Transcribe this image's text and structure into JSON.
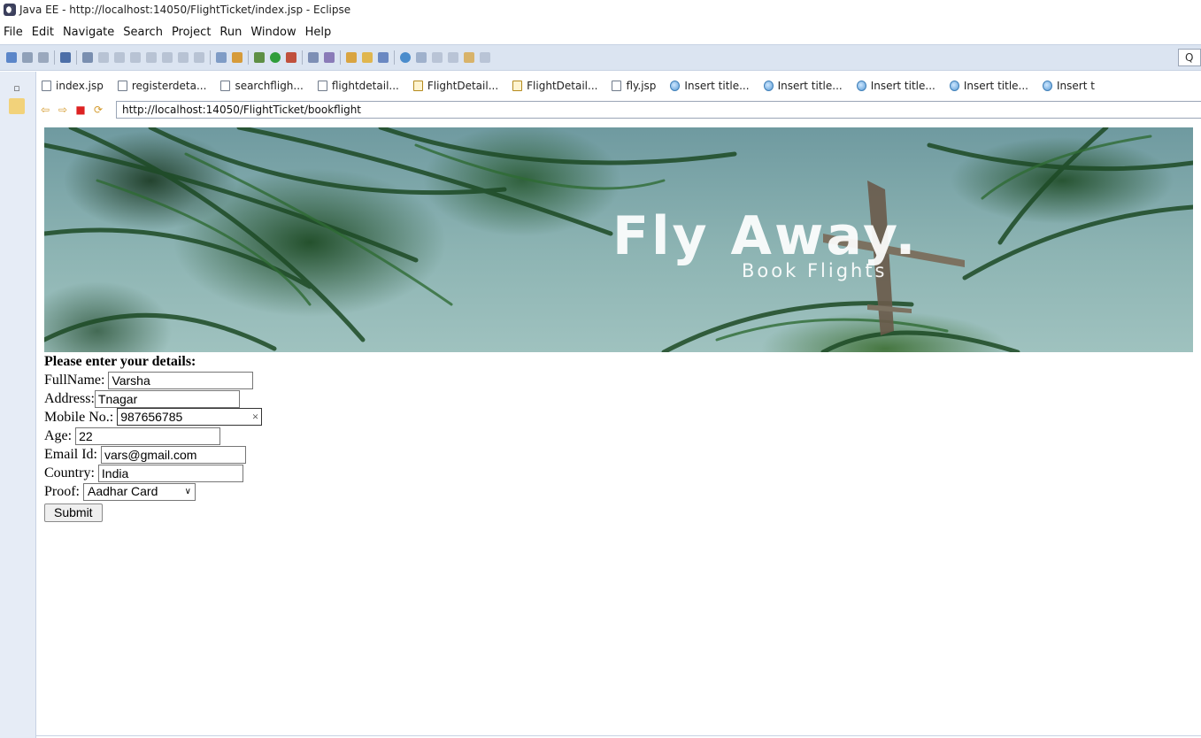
{
  "window": {
    "title": "Java EE - http://localhost:14050/FlightTicket/index.jsp - Eclipse"
  },
  "menu": [
    "File",
    "Edit",
    "Navigate",
    "Search",
    "Project",
    "Run",
    "Window",
    "Help"
  ],
  "toolbar": {
    "quick_access_label": "Q"
  },
  "tabs": [
    {
      "label": "index.jsp",
      "icon": "file-icon"
    },
    {
      "label": "registerdeta...",
      "icon": "file-icon"
    },
    {
      "label": "searchfligh...",
      "icon": "file-icon"
    },
    {
      "label": "flightdetail...",
      "icon": "file-icon"
    },
    {
      "label": "FlightDetail...",
      "icon": "java-file-icon"
    },
    {
      "label": "FlightDetail...",
      "icon": "java-file-icon"
    },
    {
      "label": "fly.jsp",
      "icon": "file-icon"
    },
    {
      "label": "Insert title...",
      "icon": "globe-icon"
    },
    {
      "label": "Insert title...",
      "icon": "globe-icon"
    },
    {
      "label": "Insert title...",
      "icon": "globe-icon"
    },
    {
      "label": "Insert title...",
      "icon": "globe-icon"
    },
    {
      "label": "Insert t",
      "icon": "globe-icon"
    }
  ],
  "browser": {
    "url": "http://localhost:14050/FlightTicket/bookflight"
  },
  "banner": {
    "title": "Fly Away.",
    "subtitle": "Book Flights"
  },
  "form": {
    "heading": "Please enter your details:",
    "fullname_label": "FullName: ",
    "fullname_value": "Varsha",
    "address_label": "Address:",
    "address_value": "Tnagar",
    "mobile_label": "Mobile No.: ",
    "mobile_value": "987656785",
    "clear_glyph": "×",
    "age_label": "Age: ",
    "age_value": "22",
    "email_label": "Email Id: ",
    "email_value": "vars@gmail.com",
    "country_label": "Country: ",
    "country_value": "India",
    "proof_label": "Proof: ",
    "proof_selected": "Aadhar Card",
    "submit_label": "Submit"
  },
  "colors": {
    "toolbar_bg": "#dbe4f1",
    "trim_bg": "#e6ecf6"
  }
}
